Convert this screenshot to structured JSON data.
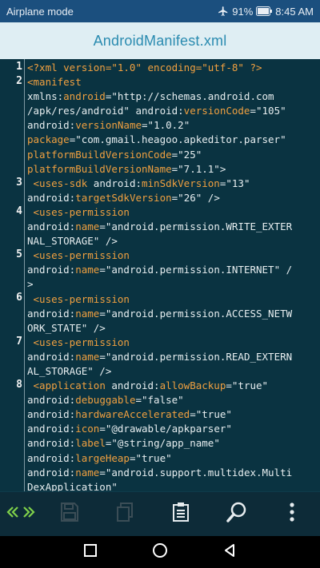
{
  "status_bar": {
    "mode_label": "Airplane mode",
    "battery": "91%",
    "time": "8:45 AM"
  },
  "title_bar": {
    "title": "AndroidManifest.xml"
  },
  "editor": {
    "line_numbers": [
      "1",
      "2",
      "3",
      "4",
      "5",
      "6",
      "7",
      "8"
    ],
    "rows": [
      [
        [
          "t-tag",
          "<?xml version=\"1.0\" encoding=\"utf-8\" ?>"
        ]
      ],
      [
        [
          "t-tag",
          "<manifest"
        ]
      ],
      [
        [
          "t-plain",
          "xmlns:"
        ],
        [
          "t-attr",
          "android"
        ],
        [
          "t-plain",
          "=\"http://schemas.android.com"
        ]
      ],
      [
        [
          "t-plain",
          "/apk/res/android\" android:"
        ],
        [
          "t-attr",
          "versionCode"
        ],
        [
          "t-plain",
          "=\"105\""
        ]
      ],
      [
        [
          "t-plain",
          "android:"
        ],
        [
          "t-attr",
          "versionName"
        ],
        [
          "t-plain",
          "=\"1.0.2\""
        ]
      ],
      [
        [
          "t-attr",
          "package"
        ],
        [
          "t-plain",
          "=\"com.gmail.heagoo.apkeditor.parser\""
        ]
      ],
      [
        [
          "t-attr",
          "platformBuildVersionCode"
        ],
        [
          "t-plain",
          "=\"25\""
        ]
      ],
      [
        [
          "t-attr",
          "platformBuildVersionName"
        ],
        [
          "t-plain",
          "=\"7.1.1\">"
        ]
      ],
      [
        [
          "t-plain",
          " "
        ],
        [
          "t-tag",
          "<uses-sdk"
        ],
        [
          "t-plain",
          " android:"
        ],
        [
          "t-attr",
          "minSdkVersion"
        ],
        [
          "t-plain",
          "=\"13\""
        ]
      ],
      [
        [
          "t-plain",
          "android:"
        ],
        [
          "t-attr",
          "targetSdkVersion"
        ],
        [
          "t-plain",
          "=\"26\" />"
        ]
      ],
      [
        [
          "t-plain",
          " "
        ],
        [
          "t-tag",
          "<uses-permission"
        ]
      ],
      [
        [
          "t-plain",
          "android:"
        ],
        [
          "t-attr",
          "name"
        ],
        [
          "t-plain",
          "=\"android.permission.WRITE_EXTER"
        ]
      ],
      [
        [
          "t-plain",
          "NAL_STORAGE\" />"
        ]
      ],
      [
        [
          "t-plain",
          " "
        ],
        [
          "t-tag",
          "<uses-permission"
        ]
      ],
      [
        [
          "t-plain",
          "android:"
        ],
        [
          "t-attr",
          "name"
        ],
        [
          "t-plain",
          "=\"android.permission.INTERNET\" /"
        ]
      ],
      [
        [
          "t-plain",
          ">"
        ]
      ],
      [
        [
          "t-plain",
          " "
        ],
        [
          "t-tag",
          "<uses-permission"
        ]
      ],
      [
        [
          "t-plain",
          "android:"
        ],
        [
          "t-attr",
          "name"
        ],
        [
          "t-plain",
          "=\"android.permission.ACCESS_NETW"
        ]
      ],
      [
        [
          "t-plain",
          "ORK_STATE\" />"
        ]
      ],
      [
        [
          "t-plain",
          " "
        ],
        [
          "t-tag",
          "<uses-permission"
        ]
      ],
      [
        [
          "t-plain",
          "android:"
        ],
        [
          "t-attr",
          "name"
        ],
        [
          "t-plain",
          "=\"android.permission.READ_EXTERN"
        ]
      ],
      [
        [
          "t-plain",
          "AL_STORAGE\" />"
        ]
      ],
      [
        [
          "t-plain",
          " "
        ],
        [
          "t-tag",
          "<application"
        ],
        [
          "t-plain",
          " android:"
        ],
        [
          "t-attr",
          "allowBackup"
        ],
        [
          "t-plain",
          "=\"true\""
        ]
      ],
      [
        [
          "t-plain",
          "android:"
        ],
        [
          "t-attr",
          "debuggable"
        ],
        [
          "t-plain",
          "=\"false\""
        ]
      ],
      [
        [
          "t-plain",
          "android:"
        ],
        [
          "t-attr",
          "hardwareAccelerated"
        ],
        [
          "t-plain",
          "=\"true\""
        ]
      ],
      [
        [
          "t-plain",
          "android:"
        ],
        [
          "t-attr",
          "icon"
        ],
        [
          "t-plain",
          "=\"@drawable/apkparser\""
        ]
      ],
      [
        [
          "t-plain",
          "android:"
        ],
        [
          "t-attr",
          "label"
        ],
        [
          "t-plain",
          "=\"@string/app_name\""
        ]
      ],
      [
        [
          "t-plain",
          "android:"
        ],
        [
          "t-attr",
          "largeHeap"
        ],
        [
          "t-plain",
          "=\"true\""
        ]
      ],
      [
        [
          "t-plain",
          "android:"
        ],
        [
          "t-attr",
          "name"
        ],
        [
          "t-plain",
          "=\"android.support.multidex.Multi"
        ]
      ],
      [
        [
          "t-plain",
          "DexApplication\""
        ]
      ]
    ]
  },
  "toolbar": {
    "icons": [
      "nav-arrows-icon",
      "save-icon",
      "copy-icon",
      "clipboard-icon",
      "search-icon",
      "more-vert-icon"
    ],
    "accent": "#7fd14a"
  },
  "nav_bar": {
    "icons": [
      "recents-icon",
      "home-icon",
      "back-icon"
    ]
  }
}
